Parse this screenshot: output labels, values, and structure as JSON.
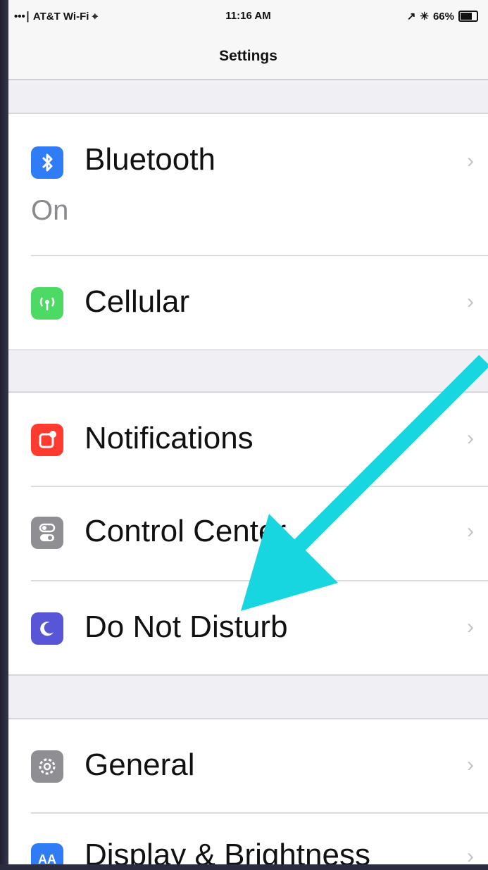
{
  "status_bar": {
    "carrier": "•••∣ AT&T Wi-Fi ⌖",
    "time": "11:16 AM",
    "battery": "66%",
    "battery_level": 0.66
  },
  "nav": {
    "title": "Settings"
  },
  "rows": {
    "bluetooth": {
      "label": "Bluetooth",
      "value": "On",
      "icon": "bluetooth-icon",
      "color": "#2f7cf6"
    },
    "cellular": {
      "label": "Cellular",
      "icon": "cellular-antenna-icon",
      "color": "#4cd964"
    },
    "notifications": {
      "label": "Notifications",
      "icon": "notifications-icon",
      "color": "#ff3b30"
    },
    "control_center": {
      "label": "Control Center",
      "icon": "control-center-icon",
      "color": "#8e8e93"
    },
    "do_not_disturb": {
      "label": "Do Not Disturb",
      "icon": "moon-icon",
      "color": "#5856d6"
    },
    "general": {
      "label": "General",
      "icon": "gear-icon",
      "color": "#8e8e93"
    },
    "display": {
      "label": "Display & Brightness",
      "icon": "display-brightness-icon",
      "color": "#2f7cf6"
    }
  },
  "chevron": "›",
  "annotation": {
    "icon": "arrow-annotation-icon",
    "color": "#18d6e0"
  }
}
